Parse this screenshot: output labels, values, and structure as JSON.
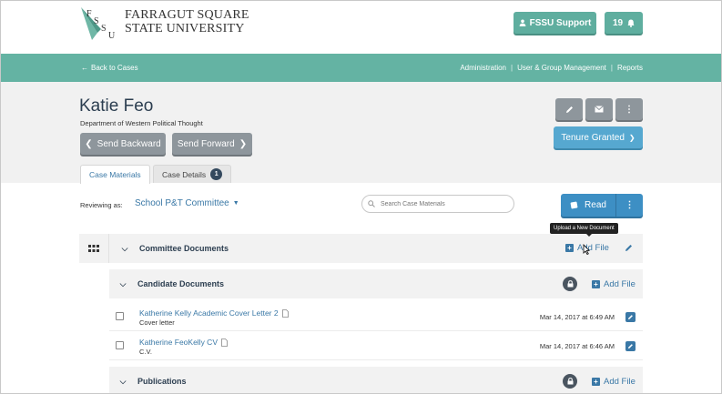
{
  "university": {
    "name_line1": "FARRAGUT SQUARE",
    "name_line2": "STATE UNIVERSITY",
    "logo_text": "FSSU"
  },
  "header": {
    "support_label": "FSSU Support",
    "notification_count": "19"
  },
  "nav": {
    "back_label": "Back to Cases",
    "links": [
      "Administration",
      "User & Group Management",
      "Reports"
    ],
    "separator": "|"
  },
  "case": {
    "name": "Katie Feo",
    "department": "Department of Western Political Thought",
    "send_backward": "Send Backward",
    "send_forward": "Send Forward",
    "status_button": "Tenure Granted"
  },
  "tabs": [
    {
      "label": "Case Materials",
      "active": true
    },
    {
      "label": "Case Details",
      "active": false,
      "badge": "1"
    }
  ],
  "review": {
    "label": "Reviewing as:",
    "value": "School P&T Committee",
    "search_placeholder": "Search Case Materials",
    "read_label": "Read"
  },
  "tooltip": "Upload a New Document",
  "folders": {
    "committee": {
      "label": "Committee Documents",
      "add_label": "Add File"
    },
    "candidate": {
      "label": "Candidate Documents",
      "add_label": "Add File"
    },
    "publications": {
      "label": "Publications",
      "add_label": "Add File"
    }
  },
  "files": [
    {
      "name": "Katherine Kelly Academic Cover Letter 2",
      "subtitle": "Cover letter",
      "date": "Mar 14, 2017 at 6:49 AM"
    },
    {
      "name": "Katherine FeoKelly CV",
      "subtitle": "C.V.",
      "date": "Mar 14, 2017 at 6:46 AM"
    }
  ],
  "colors": {
    "teal": "#64b3a3",
    "blue": "#3d8fc4",
    "grey_button": "#8e969c",
    "link": "#3a78a6"
  },
  "icons": [
    "logo-icon",
    "user-icon",
    "bell-icon",
    "arrow-left-icon",
    "pencil-icon",
    "envelope-icon",
    "more-vertical-icon",
    "chevron-left-icon",
    "chevron-right-icon",
    "chevron-down-icon",
    "caret-down-icon",
    "search-icon",
    "book-icon",
    "grid-icon",
    "plus-square-icon",
    "lock-icon",
    "pdf-icon",
    "edit-icon",
    "cursor-icon"
  ]
}
